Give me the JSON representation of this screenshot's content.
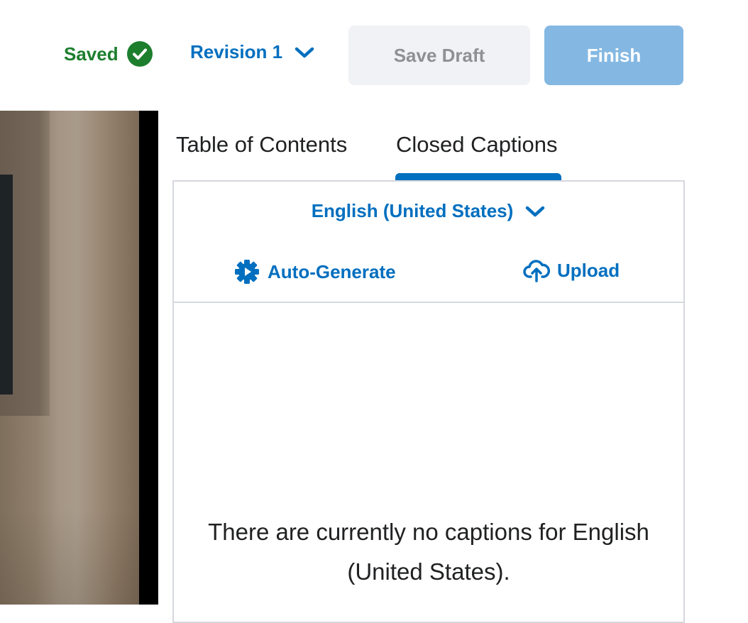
{
  "status": {
    "saved_label": "Saved",
    "saved_icon": "check-circle-icon",
    "saved_color": "#1d7e2e"
  },
  "revision": {
    "label": "Revision 1",
    "icon": "chevron-down-icon"
  },
  "buttons": {
    "save_draft": "Save Draft",
    "finish": "Finish"
  },
  "tabs": [
    {
      "label": "Table of Contents",
      "selected": false
    },
    {
      "label": "Closed Captions",
      "selected": true
    }
  ],
  "captions": {
    "language": "English (United States)",
    "auto_generate": "Auto-Generate",
    "upload": "Upload",
    "empty_message": "There are currently no captions for English (United States)."
  },
  "colors": {
    "accent": "#006fbf",
    "finish_bg": "#84b8e2",
    "draft_bg": "#f1f2f5"
  }
}
